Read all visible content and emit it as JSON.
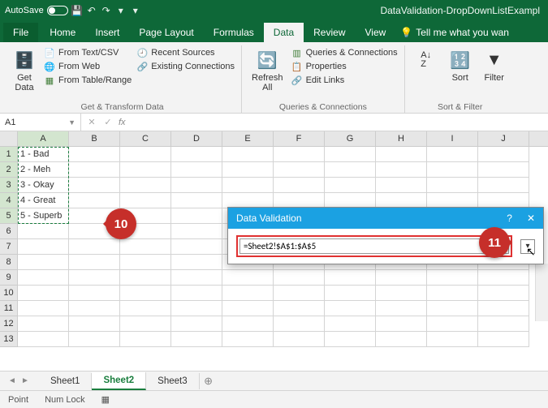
{
  "titlebar": {
    "autosave": "AutoSave",
    "doc": "DataValidation-DropDownListExampl"
  },
  "tabs": {
    "file": "File",
    "home": "Home",
    "insert": "Insert",
    "page": "Page Layout",
    "formulas": "Formulas",
    "data": "Data",
    "review": "Review",
    "view": "View",
    "tellme": "Tell me what you wan"
  },
  "ribbon": {
    "getdata": "Get\nData",
    "fromtext": "From Text/CSV",
    "fromweb": "From Web",
    "fromtable": "From Table/Range",
    "recent": "Recent Sources",
    "existing": "Existing Connections",
    "group1": "Get & Transform Data",
    "refresh": "Refresh\nAll",
    "queries": "Queries & Connections",
    "props": "Properties",
    "editlinks": "Edit Links",
    "group2": "Queries & Connections",
    "sort": "Sort",
    "filter": "Filter",
    "group3": "Sort & Filter"
  },
  "namebox": "A1",
  "cells": {
    "a1": "1 - Bad",
    "a2": "2 - Meh",
    "a3": "3 - Okay",
    "a4": "4 - Great",
    "a5": "5 - Superb"
  },
  "cols": [
    "A",
    "B",
    "C",
    "D",
    "E",
    "F",
    "G",
    "H",
    "I",
    "J"
  ],
  "callouts": {
    "c10": "10",
    "c11": "11"
  },
  "dialog": {
    "title": "Data Validation",
    "help": "?",
    "close": "✕",
    "formula": "=Sheet2!$A$1:$A$5"
  },
  "sheets": {
    "s1": "Sheet1",
    "s2": "Sheet2",
    "s3": "Sheet3"
  },
  "status": {
    "mode": "Point",
    "numlock": "Num Lock"
  }
}
